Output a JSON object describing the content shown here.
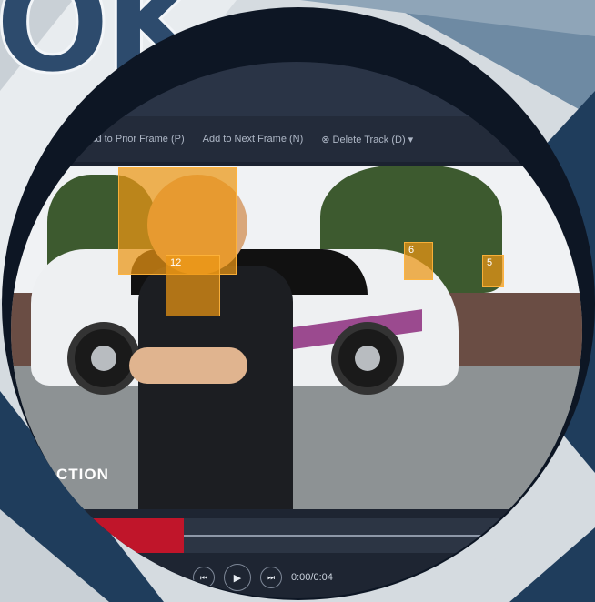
{
  "header_letters": "OK",
  "colors": {
    "navy": "#1f3d5c",
    "dark": "#0d1624",
    "accent_red": "#c0152a",
    "bbox_orange": "#eb9614"
  },
  "toolbar": {
    "add_prior": "Add to Prior Frame (P)",
    "add_next": "Add to Next Frame (N)",
    "delete_track": "⊗  Delete Track (D)  ▾"
  },
  "annotations": [
    {
      "label": "",
      "kind": "face"
    },
    {
      "label": "12",
      "kind": "badge"
    },
    {
      "label": "6",
      "kind": "person"
    },
    {
      "label": "5",
      "kind": "person"
    }
  ],
  "watermark": "CTION",
  "player": {
    "prev_icon": "skip-back-icon",
    "play_icon": "play-icon",
    "next_icon": "skip-forward-icon",
    "time": "0:00/0:04"
  }
}
